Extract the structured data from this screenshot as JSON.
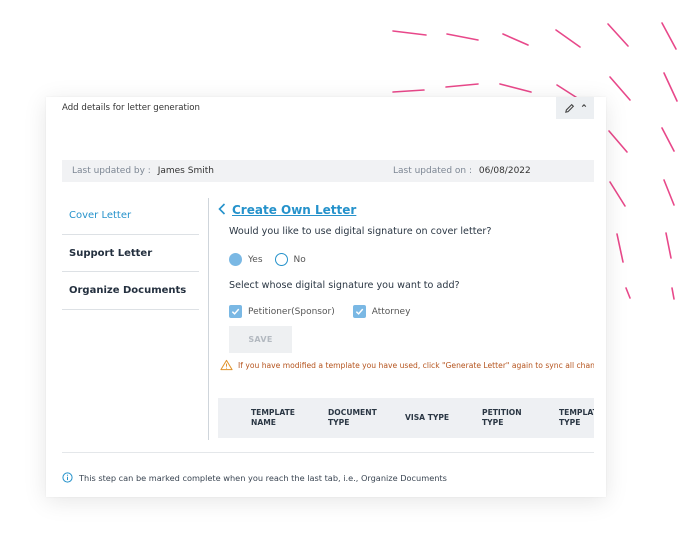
{
  "header": {
    "title": "Add details for letter generation"
  },
  "updated": {
    "by_label": "Last updated by :",
    "by_value": "James Smith",
    "on_label": "Last updated on :",
    "on_value": "06/08/2022"
  },
  "sidebar": {
    "items": [
      {
        "label": "Cover Letter",
        "active": true
      },
      {
        "label": "Support Letter",
        "active": false
      },
      {
        "label": "Organize Documents",
        "active": false
      }
    ]
  },
  "main": {
    "back_title": "Create Own Letter",
    "question_signature": "Would you like to use digital signature on cover letter?",
    "radio_options": [
      {
        "label": "Yes",
        "selected": true
      },
      {
        "label": "No",
        "selected": false
      }
    ],
    "question_whose": "Select whose digital signature you want to add?",
    "checkbox_options": [
      {
        "label": "Petitioner(Sponsor)",
        "checked": true
      },
      {
        "label": "Attorney",
        "checked": true
      }
    ],
    "save_label": "SAVE",
    "warning": "If you have modified a template you have used, click \"Generate Letter\" again to sync all changes."
  },
  "table": {
    "columns": [
      "TEMPLATE\nNAME",
      "DOCUMENT\nTYPE",
      "VISA TYPE",
      "PETITION\nTYPE",
      "TEMPLATE\nTYPE"
    ]
  },
  "footer": {
    "note": "This step can be marked complete when you reach the last tab, i.e., Organize Documents"
  },
  "colors": {
    "accent": "#2592cb",
    "warning": "#b5541e",
    "decoration": "#e8488a"
  },
  "icons": [
    "chevron-left-icon",
    "warning-icon",
    "info-icon",
    "pencil-icon"
  ]
}
